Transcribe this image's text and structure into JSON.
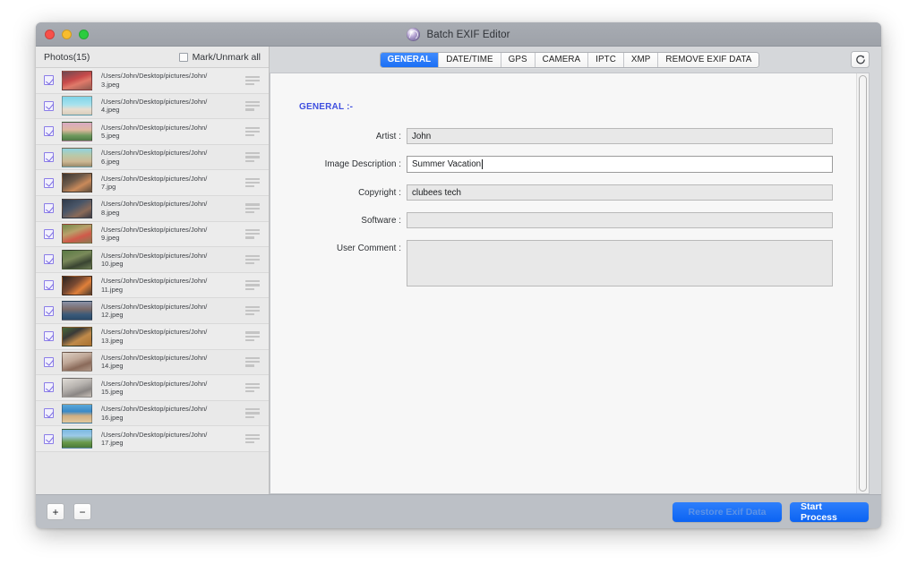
{
  "window": {
    "title": "Batch EXIF Editor",
    "app_icon": "swirl-icon",
    "traffic_lights": [
      "close",
      "minimize",
      "zoom"
    ]
  },
  "sidebar": {
    "header_label": "Photos(15)",
    "mark_all_label": "Mark/Unmark all",
    "mark_all_checked": false,
    "items": [
      {
        "path": "/Users/John/Desktop/pictures/John/",
        "file": "3.jpeg",
        "checked": true,
        "thumb": "linear-gradient(160deg,#6b4a52 0%,#c84a4a 42%,#e07a6a 62%,#8e5a50 100%)"
      },
      {
        "path": "/Users/John/Desktop/pictures/John/",
        "file": "4.jpeg",
        "checked": true,
        "thumb": "linear-gradient(180deg,#7fd4e8 0%,#a8e2ee 45%,#e8ded0 70%,#d9cdbc 100%)"
      },
      {
        "path": "/Users/John/Desktop/pictures/John/",
        "file": "5.jpeg",
        "checked": true,
        "thumb": "linear-gradient(180deg,#d7a9c4 0%,#e0b8a0 40%,#6f9a5e 72%,#4e7a46 100%)"
      },
      {
        "path": "/Users/John/Desktop/pictures/John/",
        "file": "6.jpeg",
        "checked": true,
        "thumb": "linear-gradient(180deg,#8fd3e0 0%,#b9c9a8 38%,#cdb894 72%,#9a8a6a 100%)"
      },
      {
        "path": "/Users/John/Desktop/pictures/John/",
        "file": "7.jpg",
        "checked": true,
        "thumb": "linear-gradient(150deg,#3a3530 0%,#6d5a4a 38%,#c98a5a 66%,#5a4c3e 100%)"
      },
      {
        "path": "/Users/John/Desktop/pictures/John/",
        "file": "8.jpeg",
        "checked": true,
        "thumb": "linear-gradient(150deg,#2f3a4a 0%,#4a5668 40%,#8a6a58 70%,#3a3a44 100%)"
      },
      {
        "path": "/Users/John/Desktop/pictures/John/",
        "file": "9.jpeg",
        "checked": true,
        "thumb": "linear-gradient(160deg,#6f8a4a 0%,#b8a06a 38%,#d05a4a 66%,#8a7a52 100%)"
      },
      {
        "path": "/Users/John/Desktop/pictures/John/",
        "file": "10.jpeg",
        "checked": true,
        "thumb": "linear-gradient(160deg,#5a7a44 0%,#7a8a5a 40%,#3a4432 70%,#6a7a52 100%)"
      },
      {
        "path": "/Users/John/Desktop/pictures/John/",
        "file": "11.jpeg",
        "checked": true,
        "thumb": "linear-gradient(140deg,#2a2420 0%,#7a4a32 42%,#e0803a 66%,#4a3a2e 100%)"
      },
      {
        "path": "/Users/John/Desktop/pictures/John/",
        "file": "12.jpeg",
        "checked": true,
        "thumb": "linear-gradient(180deg,#8a92a8 0%,#7a6a68 42%,#3a5a7a 72%,#2a4a68 100%)"
      },
      {
        "path": "/Users/John/Desktop/pictures/John/",
        "file": "13.jpeg",
        "checked": true,
        "thumb": "linear-gradient(150deg,#4a6a3a 0%,#3a3a38 34%,#c08a4a 62%,#a8702e 100%)"
      },
      {
        "path": "/Users/John/Desktop/pictures/John/",
        "file": "14.jpeg",
        "checked": true,
        "thumb": "linear-gradient(160deg,#dcd0c4 0%,#c0a898 40%,#8a6a5a 70%,#b09888 100%)"
      },
      {
        "path": "/Users/John/Desktop/pictures/John/",
        "file": "15.jpeg",
        "checked": true,
        "thumb": "linear-gradient(160deg,#e0dcd6 0%,#b8b4b0 42%,#8a8684 72%,#c8c0b8 100%)"
      },
      {
        "path": "/Users/John/Desktop/pictures/John/",
        "file": "16.jpeg",
        "checked": true,
        "thumb": "linear-gradient(180deg,#5aa8d8 0%,#3a8ac8 38%,#cfae82 62%,#e2c89e 100%)"
      },
      {
        "path": "/Users/John/Desktop/pictures/John/",
        "file": "17.jpeg",
        "checked": true,
        "thumb": "linear-gradient(180deg,#7ab8e0 0%,#9ccae8 34%,#6a9a4a 70%,#4a7a38 100%)"
      }
    ],
    "row_menu_icon": "list-handle-icon"
  },
  "tabs": {
    "items": [
      {
        "label": "GENERAL",
        "active": true
      },
      {
        "label": "DATE/TIME",
        "active": false
      },
      {
        "label": "GPS",
        "active": false
      },
      {
        "label": "CAMERA",
        "active": false
      },
      {
        "label": "IPTC",
        "active": false
      },
      {
        "label": "XMP",
        "active": false
      },
      {
        "label": "REMOVE EXIF DATA",
        "active": false
      }
    ],
    "active_color": "#1b6ff5",
    "refresh_icon": "refresh-icon"
  },
  "form": {
    "section_title": "GENERAL :-",
    "fields": [
      {
        "label": "Artist :",
        "value": "John",
        "focused": false,
        "type": "text"
      },
      {
        "label": "Image Description :",
        "value": "Summer Vacation",
        "focused": true,
        "type": "text"
      },
      {
        "label": "Copyright :",
        "value": "clubees tech",
        "focused": false,
        "type": "text"
      },
      {
        "label": "Software :",
        "value": "",
        "focused": false,
        "type": "text"
      },
      {
        "label": "User Comment :",
        "value": "",
        "focused": false,
        "type": "textarea"
      }
    ]
  },
  "footer": {
    "add_label": "+",
    "remove_label": "−",
    "restore_label": "Restore Exif Data",
    "restore_disabled": true,
    "start_label": "Start Process",
    "button_color": "#0b63f3"
  }
}
